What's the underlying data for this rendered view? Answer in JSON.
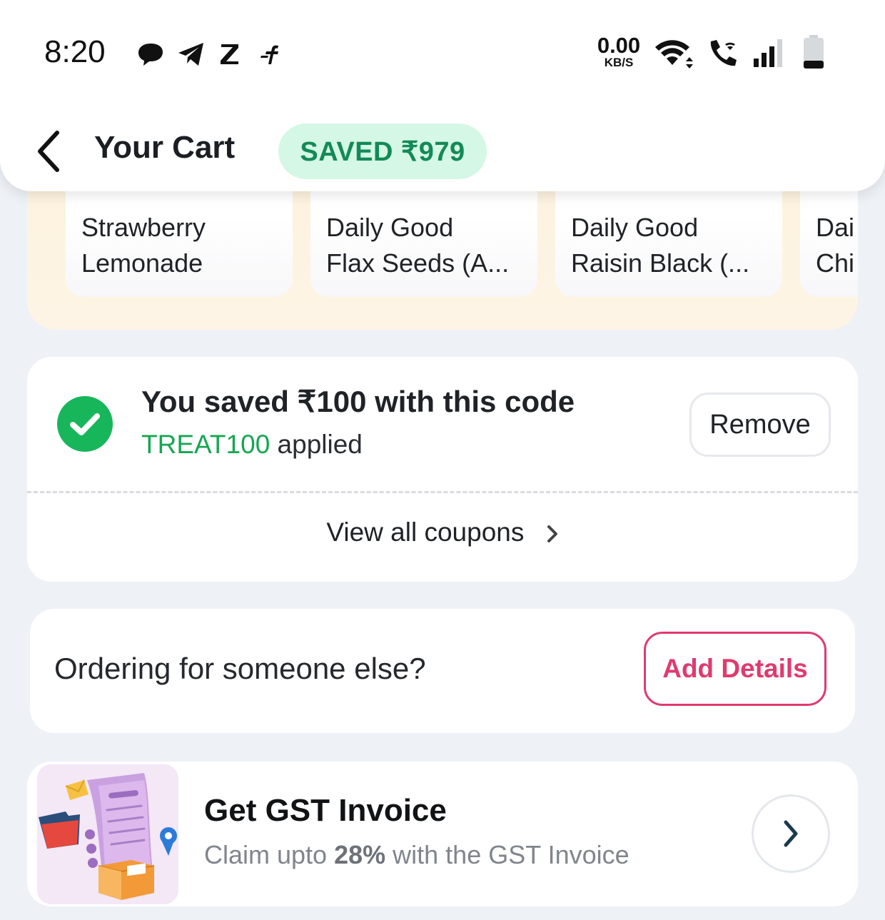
{
  "status_bar": {
    "time": "8:20",
    "net_speed_value": "0.00",
    "net_speed_unit": "KB/S",
    "notification_icons": [
      "chat-bubble-icon",
      "telegram-icon",
      "z-app-icon",
      "flipkart-icon"
    ],
    "system_icons": [
      "wifi-icon",
      "wifi-call-icon",
      "signal-icon",
      "battery-icon"
    ]
  },
  "header": {
    "title": "Your Cart",
    "saved_badge": "SAVED ₹979"
  },
  "suggestions": {
    "items": [
      {
        "line1": "Strawberry",
        "line2": "Lemonade"
      },
      {
        "line1": "Daily Good",
        "line2": "Flax Seeds (A..."
      },
      {
        "line1": "Daily Good",
        "line2": "Raisin Black (..."
      },
      {
        "line1": "Dai",
        "line2": "Chi"
      }
    ]
  },
  "coupon": {
    "title": "You saved ₹100 with this code",
    "code": "TREAT100",
    "applied_text": " applied",
    "remove_label": "Remove",
    "view_all_label": "View all coupons"
  },
  "ordering": {
    "question": "Ordering for someone else?",
    "button_label": "Add Details"
  },
  "gst": {
    "title": "Get GST Invoice",
    "sub_prefix": "Claim upto ",
    "sub_bold": "28%",
    "sub_suffix": " with the GST Invoice"
  },
  "colors": {
    "accent_green": "#17b65b",
    "saved_green": "#138a57",
    "pink": "#e03a6f",
    "background": "#eef1f6"
  }
}
